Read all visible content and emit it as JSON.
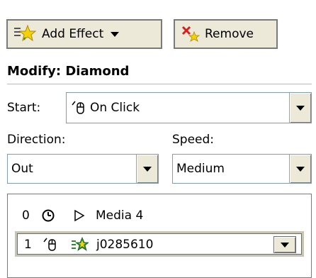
{
  "toolbar": {
    "add_effect_label": "Add Effect",
    "add_effect_icon": "add-effect-star-icon",
    "remove_label": "Remove",
    "remove_icon": "remove-x-icon"
  },
  "modify": {
    "heading": "Modify: Diamond",
    "start_label": "Start:",
    "start_value": "On Click",
    "start_icon": "mouse-click-icon",
    "direction_label": "Direction:",
    "direction_value": "Out",
    "speed_label": "Speed:",
    "speed_value": "Medium"
  },
  "effects_list": [
    {
      "index": "0",
      "trigger_icon": "clock-icon",
      "effect_icon": "play-triangle-icon",
      "name": "Media 4",
      "selected": false
    },
    {
      "index": "1",
      "trigger_icon": "mouse-click-icon",
      "effect_icon": "star-effect-icon",
      "name": "j0285610",
      "selected": true
    }
  ],
  "colors": {
    "button_face": "#ece9d8",
    "combo_border": "#7f9db9",
    "star_green": "#2e8b2e",
    "star_yellow": "#f5d10a",
    "remove_red": "#d42020"
  }
}
